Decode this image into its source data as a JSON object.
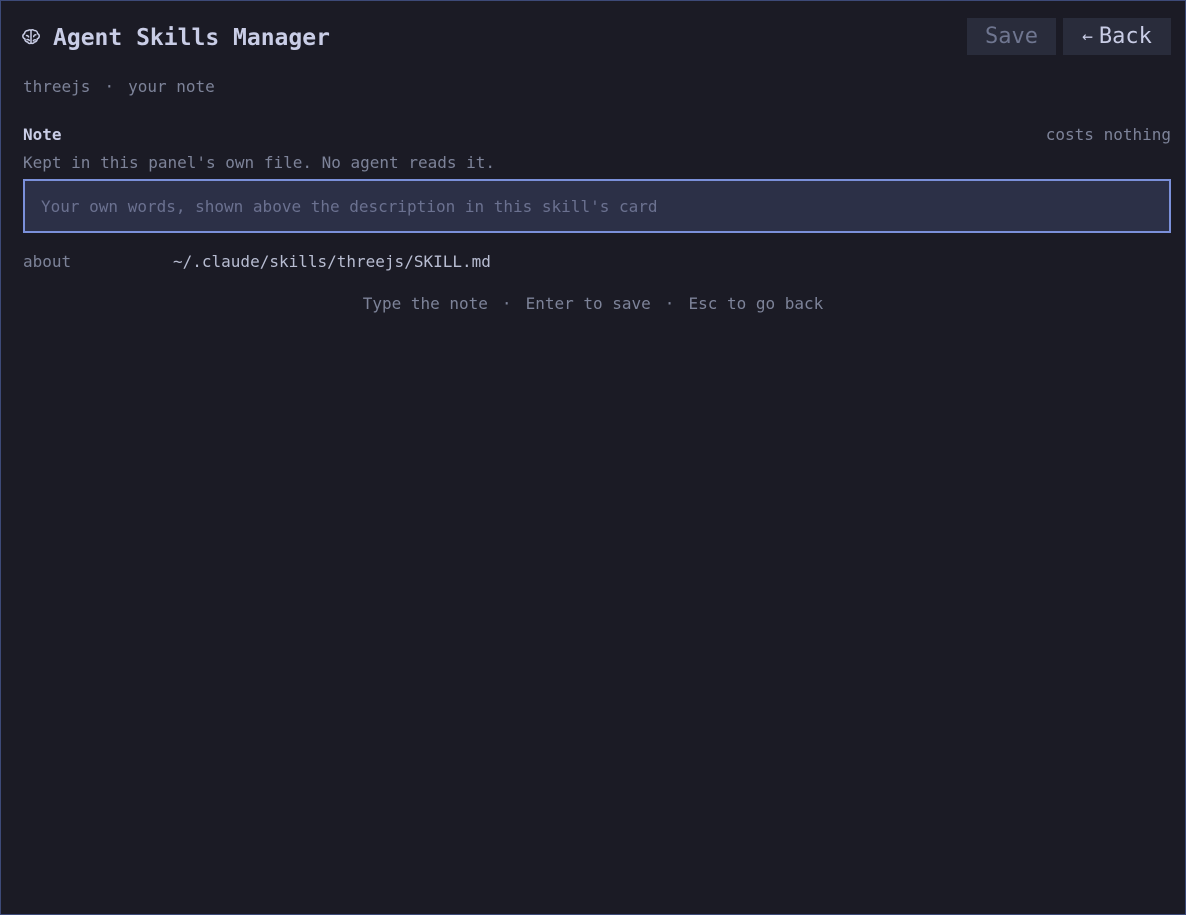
{
  "app": {
    "title": "Agent Skills Manager",
    "icon": "brain-icon"
  },
  "toolbar": {
    "save_label": "Save",
    "back_arrow": "←",
    "back_label": "Back"
  },
  "breadcrumb": {
    "skill": "threejs",
    "separator": "·",
    "page": "your note"
  },
  "note_section": {
    "label": "Note",
    "cost": "costs nothing",
    "hint": "Kept in this panel's own file. No agent reads it.",
    "input_value": "",
    "input_placeholder": "Your own words, shown above the description in this skill's card"
  },
  "about": {
    "label": "about",
    "path": "~/.claude/skills/threejs/SKILL.md"
  },
  "footer": {
    "hint_1": "Type the note",
    "separator": "·",
    "hint_2": "Enter to save",
    "hint_3": "Esc to go back"
  },
  "colors": {
    "background": "#1b1b25",
    "input_background": "#2c3047",
    "input_border": "#7b90da",
    "button_background": "#292c3b",
    "muted_text": "#7d8399",
    "primary_text": "#c9cde6"
  }
}
